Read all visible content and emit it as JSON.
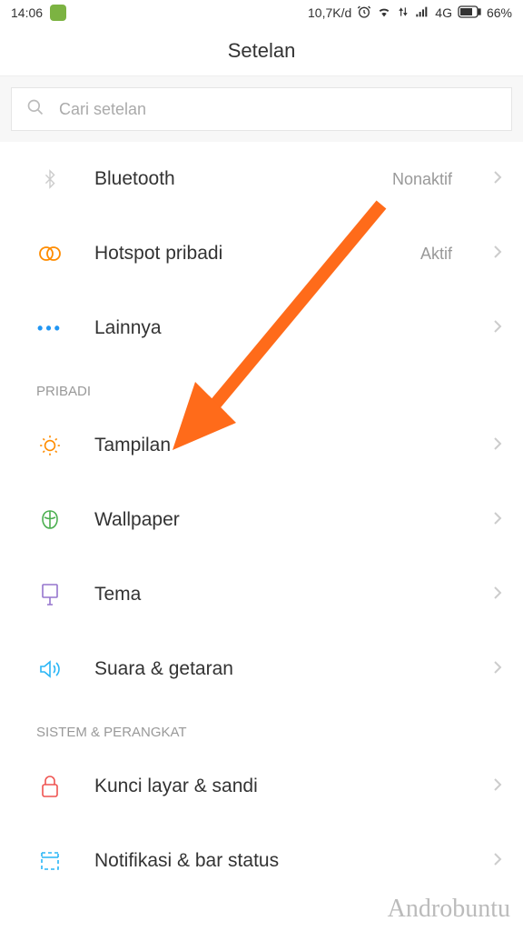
{
  "status_bar": {
    "time": "14:06",
    "network_speed": "10,7K/d",
    "network_type": "4G",
    "battery": "66%"
  },
  "header": {
    "title": "Setelan"
  },
  "search": {
    "placeholder": "Cari setelan"
  },
  "items": {
    "bluetooth": {
      "label": "Bluetooth",
      "status": "Nonaktif"
    },
    "hotspot": {
      "label": "Hotspot pribadi",
      "status": "Aktif"
    },
    "lainnya": {
      "label": "Lainnya"
    },
    "tampilan": {
      "label": "Tampilan"
    },
    "wallpaper": {
      "label": "Wallpaper"
    },
    "tema": {
      "label": "Tema"
    },
    "suara": {
      "label": "Suara & getaran"
    },
    "kunci": {
      "label": "Kunci layar & sandi"
    },
    "notifikasi": {
      "label": "Notifikasi & bar status"
    }
  },
  "sections": {
    "pribadi": "PRIBADI",
    "sistem": "SISTEM & PERANGKAT"
  },
  "watermark": "Androbuntu"
}
